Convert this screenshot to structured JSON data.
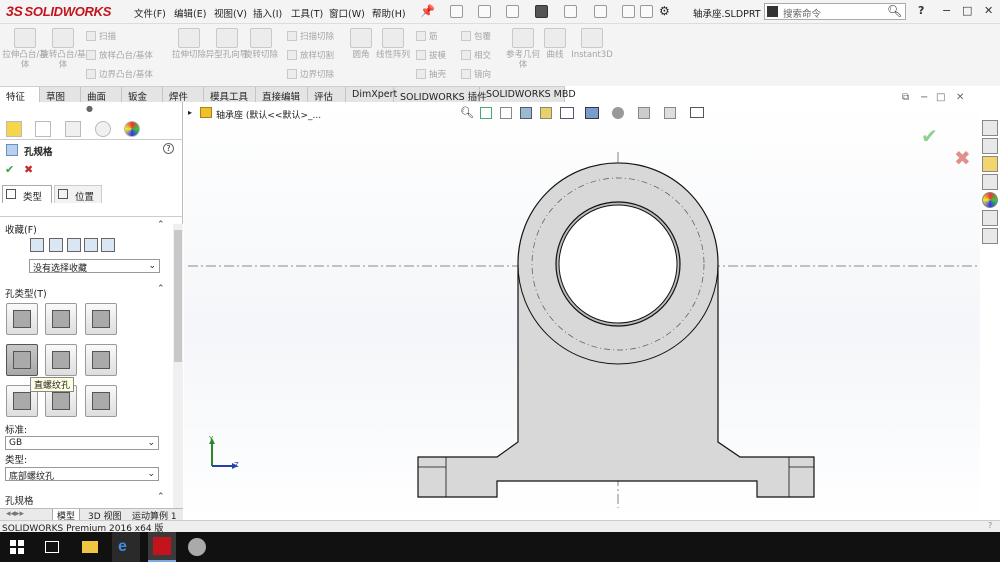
{
  "app": {
    "logo_text": "SOLIDWORKS",
    "logo_prefix": "3S"
  },
  "menu": [
    "文件(F)",
    "编辑(E)",
    "视图(V)",
    "插入(I)",
    "工具(T)",
    "窗口(W)",
    "帮助(H)"
  ],
  "document_name": "轴承座.SLDPRT",
  "search": {
    "placeholder": "搜索命令"
  },
  "window_buttons": [
    "?",
    "−",
    "□",
    "✕"
  ],
  "ribbon": {
    "large_tools": [
      "拉伸凸台/基体",
      "旋转凸台/基体",
      "拉伸切除",
      "异型孔向导",
      "旋转切除",
      "圆角",
      "线性阵列",
      "参考几何体",
      "曲线",
      "Instant3D"
    ],
    "small_tools_1": [
      "扫描",
      "放样凸台/基体",
      "边界凸台/基体"
    ],
    "small_tools_2": [
      "扫描切除",
      "放样切割",
      "边界切除"
    ],
    "small_tools_3": [
      "筋",
      "拔模",
      "抽壳"
    ],
    "small_tools_4": [
      "包覆",
      "相交",
      "镜向"
    ]
  },
  "command_tabs": [
    "特征",
    "草图",
    "曲面",
    "钣金",
    "焊件",
    "模具工具",
    "直接编辑",
    "评估",
    "DimXpert",
    "SOLIDWORKS 插件",
    "SOLIDWORKS MBD"
  ],
  "feature_tree_path": "轴承座 (默认<<默认>_...",
  "property_manager": {
    "title": "孔规格",
    "ok_label": "✔",
    "cancel_label": "✖",
    "help_label": "?",
    "sub_tabs": [
      "类型",
      "位置"
    ],
    "favorites_header": "收藏(F)",
    "favorites_select": "没有选择收藏",
    "hole_type_header": "孔类型(T)",
    "hole_tooltip": "直螺纹孔",
    "standard_label": "标准:",
    "standard_value": "GB",
    "type_label": "类型:",
    "type_value": "底部螺纹孔",
    "hole_spec_header": "孔规格"
  },
  "bottom_tabs": [
    "模型",
    "3D 视图",
    "运动算例 1"
  ],
  "status_text": "SOLIDWORKS Premium 2016 x64 版",
  "triad": {
    "y_label": "Y",
    "z_label": "Z"
  },
  "colors": {
    "brand": "#c3141e",
    "accept": "#4caf50",
    "reject": "#d9534f",
    "part_fill": "#d6d6d6"
  }
}
